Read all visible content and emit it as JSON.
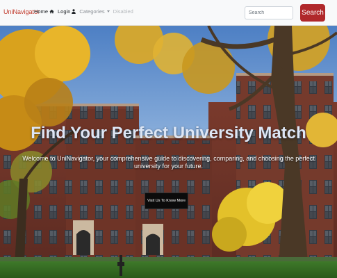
{
  "navbar": {
    "brand": "UniNavigator",
    "links": [
      {
        "label": "Home",
        "icon": "home-icon"
      },
      {
        "label": "Login",
        "icon": "user-icon"
      },
      {
        "label": "Categories",
        "icon": "caret-down-icon"
      },
      {
        "label": "Disabled"
      }
    ],
    "search": {
      "placeholder": "Search",
      "value": "",
      "button_label": "Search"
    },
    "colors": {
      "brand": "#c0392b",
      "search_button": "#b0282b"
    }
  },
  "hero": {
    "title": "Find Your Perfect University Match",
    "subtitle": "Welcome to UniNavigator, your comprehensive guide to discovering, comparing, and choosing the perfect university for your future.",
    "cta_label": "Visit Us To Know More"
  }
}
